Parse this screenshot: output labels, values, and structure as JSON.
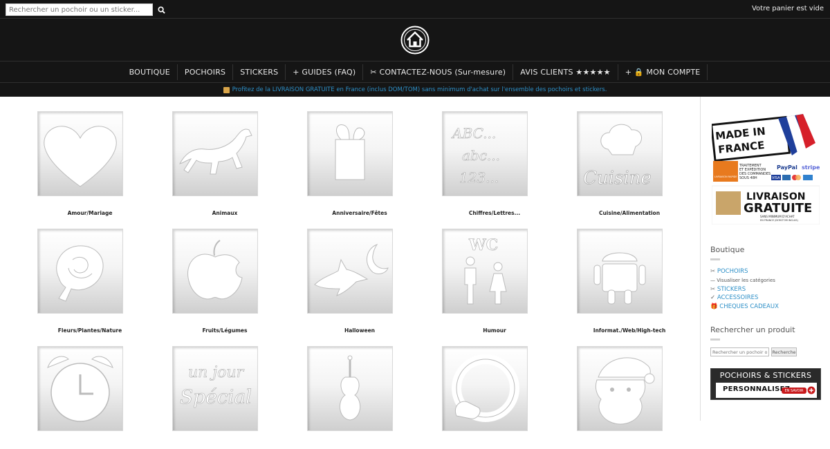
{
  "header": {
    "search_placeholder": "Rechercher un pochoir ou un sticker...",
    "cart_text": "Votre panier est vide"
  },
  "nav": {
    "items": [
      {
        "label": "BOUTIQUE"
      },
      {
        "label": "POCHOIRS"
      },
      {
        "label": "STICKERS"
      },
      {
        "label": "+ GUIDES (FAQ)"
      },
      {
        "label": "✂ CONTACTEZ-NOUS (Sur-mesure)"
      },
      {
        "label": "AVIS CLIENTS ★★★★★"
      },
      {
        "label": "+ 🔒 MON COMPTE"
      }
    ]
  },
  "promo": {
    "text": "Profitez de la LIVRAISON GRATUITE en France (inclus DOM/TOM) sans minimum d'achat sur l'ensemble des pochoirs et stickers."
  },
  "categories": [
    {
      "label": "Amour/Mariage",
      "icon": "heart-icon"
    },
    {
      "label": "Animaux",
      "icon": "horse-icon"
    },
    {
      "label": "Anniversaire/Fêtes",
      "icon": "gift-icon"
    },
    {
      "label": "Chiffres/Lettres...",
      "icon": "abc-icon"
    },
    {
      "label": "Cuisine/Alimentation",
      "icon": "chef-hat-icon"
    },
    {
      "label": "Fleurs/Plantes/Nature",
      "icon": "rose-icon"
    },
    {
      "label": "Fruits/Légumes",
      "icon": "apple-icon"
    },
    {
      "label": "Halloween",
      "icon": "witch-moon-icon"
    },
    {
      "label": "Humour",
      "icon": "wc-icon"
    },
    {
      "label": "Informat./Web/High-tech",
      "icon": "android-icon"
    },
    {
      "label": "",
      "icon": "alarm-clock-icon"
    },
    {
      "label": "",
      "icon": "un-jour-special-icon"
    },
    {
      "label": "",
      "icon": "violin-icon"
    },
    {
      "label": "",
      "icon": "pacifier-icon"
    },
    {
      "label": "",
      "icon": "santa-icon"
    }
  ],
  "stencil_texts": {
    "abc_line1": "ABC...",
    "abc_line2": "abc...",
    "abc_line3": "123...",
    "cuisine": "Cuisine",
    "wc": "WC",
    "un_jour": "un jour",
    "special": "Spécial"
  },
  "sidebar": {
    "badge": {
      "made_in_line1": "MADE IN",
      "made_in_line2": "FRANCE",
      "shipping_line1": "TRAITEMENT",
      "shipping_line2": "ET EXPÉDITION",
      "shipping_line3": "DES COMMANDES",
      "shipping_line4": "SOUS 48H",
      "livraison_rapide": "LIVRAISON RAPIDE",
      "paypal": "PayPal",
      "stripe": "stripe",
      "visa": "VISA",
      "livraison": "LIVRAISON",
      "gratuite": "GRATUITE",
      "sans_minimum": "SANS MINIMUM D'ACHAT",
      "en_france": "EN FRANCE (DOM-TOM INCLUS)"
    },
    "boutique_title": "Boutique",
    "links": {
      "pochoirs": "POCHOIRS",
      "visualiser": "Visualiser les catégories",
      "stickers": "STICKERS",
      "accessoires": "ACCESSOIRES",
      "cheques": "CHEQUES CADEAUX"
    },
    "search_title": "Rechercher un produit",
    "search_placeholder": "Rechercher un pochoir ou",
    "search_button": "Recherche",
    "banner_title": "POCHOIRS & STICKERS",
    "banner_personnalisez": "PERSONNALISEZ",
    "banner_en_savoir": "EN SAVOIR"
  },
  "colors": {
    "header_bg": "#151515",
    "link_blue": "#2d8fc7"
  }
}
